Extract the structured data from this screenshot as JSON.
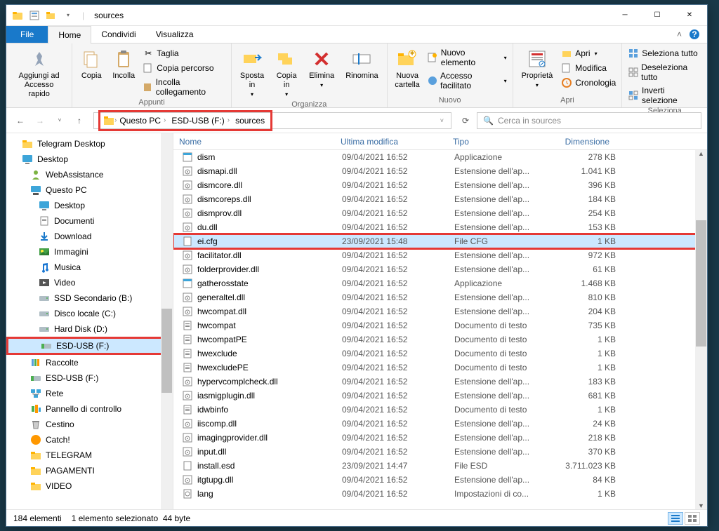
{
  "window": {
    "title": "sources"
  },
  "tabs": {
    "file": "File",
    "home": "Home",
    "share": "Condividi",
    "view": "Visualizza"
  },
  "ribbon": {
    "quick_access": {
      "pin": "Aggiungi ad\nAccesso rapido"
    },
    "clipboard": {
      "group": "Appunti",
      "copy": "Copia",
      "paste": "Incolla",
      "cut": "Taglia",
      "copy_path": "Copia percorso",
      "paste_shortcut": "Incolla collegamento"
    },
    "organize": {
      "group": "Organizza",
      "move": "Sposta\nin",
      "copy_to": "Copia\nin",
      "delete": "Elimina",
      "rename": "Rinomina"
    },
    "new": {
      "group": "Nuovo",
      "new_folder": "Nuova\ncartella",
      "new_item": "Nuovo elemento",
      "easy_access": "Accesso facilitato"
    },
    "open": {
      "group": "Apri",
      "properties": "Proprietà",
      "open": "Apri",
      "edit": "Modifica",
      "history": "Cronologia"
    },
    "select": {
      "group": "Seleziona",
      "select_all": "Seleziona tutto",
      "select_none": "Deseleziona tutto",
      "invert": "Inverti selezione"
    }
  },
  "breadcrumb": {
    "root": "Questo PC",
    "drive": "ESD-USB (F:)",
    "folder": "sources"
  },
  "search": {
    "placeholder": "Cerca in sources"
  },
  "tree": [
    {
      "label": "Telegram Desktop",
      "icon": "folder",
      "lvl": 0
    },
    {
      "label": "Desktop",
      "icon": "desktop",
      "lvl": 0,
      "bold": true
    },
    {
      "label": "WebAssistance",
      "icon": "user",
      "lvl": 1
    },
    {
      "label": "Questo PC",
      "icon": "pc",
      "lvl": 1
    },
    {
      "label": "Desktop",
      "icon": "desktop",
      "lvl": 2
    },
    {
      "label": "Documenti",
      "icon": "docs",
      "lvl": 2
    },
    {
      "label": "Download",
      "icon": "download",
      "lvl": 2
    },
    {
      "label": "Immagini",
      "icon": "images",
      "lvl": 2
    },
    {
      "label": "Musica",
      "icon": "music",
      "lvl": 2
    },
    {
      "label": "Video",
      "icon": "video",
      "lvl": 2
    },
    {
      "label": "SSD Secondario (B:)",
      "icon": "drive",
      "lvl": 2
    },
    {
      "label": "Disco locale (C:)",
      "icon": "drive",
      "lvl": 2
    },
    {
      "label": "Hard Disk (D:)",
      "icon": "drive",
      "lvl": 2
    },
    {
      "label": "ESD-USB (F:)",
      "icon": "usb",
      "lvl": 2,
      "sel": true
    },
    {
      "label": "Raccolte",
      "icon": "lib",
      "lvl": 1
    },
    {
      "label": "ESD-USB (F:)",
      "icon": "usb",
      "lvl": 1
    },
    {
      "label": "Rete",
      "icon": "net",
      "lvl": 1
    },
    {
      "label": "Pannello di controllo",
      "icon": "cp",
      "lvl": 1
    },
    {
      "label": "Cestino",
      "icon": "bin",
      "lvl": 1
    },
    {
      "label": "Catch!",
      "icon": "catch",
      "lvl": 1
    },
    {
      "label": "TELEGRAM",
      "icon": "folder",
      "lvl": 1
    },
    {
      "label": "PAGAMENTI",
      "icon": "folder",
      "lvl": 1
    },
    {
      "label": "VIDEO",
      "icon": "folder",
      "lvl": 1
    }
  ],
  "columns": {
    "name": "Nome",
    "date": "Ultima modifica",
    "type": "Tipo",
    "size": "Dimensione"
  },
  "files": [
    {
      "name": "dism",
      "date": "09/04/2021 16:52",
      "type": "Applicazione",
      "size": "278 KB",
      "icon": "exe"
    },
    {
      "name": "dismapi.dll",
      "date": "09/04/2021 16:52",
      "type": "Estensione dell'ap...",
      "size": "1.041 KB",
      "icon": "dll"
    },
    {
      "name": "dismcore.dll",
      "date": "09/04/2021 16:52",
      "type": "Estensione dell'ap...",
      "size": "396 KB",
      "icon": "dll"
    },
    {
      "name": "dismcoreps.dll",
      "date": "09/04/2021 16:52",
      "type": "Estensione dell'ap...",
      "size": "184 KB",
      "icon": "dll"
    },
    {
      "name": "dismprov.dll",
      "date": "09/04/2021 16:52",
      "type": "Estensione dell'ap...",
      "size": "254 KB",
      "icon": "dll"
    },
    {
      "name": "du.dll",
      "date": "09/04/2021 16:52",
      "type": "Estensione dell'ap...",
      "size": "153 KB",
      "icon": "dll"
    },
    {
      "name": "ei.cfg",
      "date": "23/09/2021 15:48",
      "type": "File CFG",
      "size": "1 KB",
      "icon": "file",
      "sel": true
    },
    {
      "name": "facilitator.dll",
      "date": "09/04/2021 16:52",
      "type": "Estensione dell'ap...",
      "size": "972 KB",
      "icon": "dll"
    },
    {
      "name": "folderprovider.dll",
      "date": "09/04/2021 16:52",
      "type": "Estensione dell'ap...",
      "size": "61 KB",
      "icon": "dll"
    },
    {
      "name": "gatherosstate",
      "date": "09/04/2021 16:52",
      "type": "Applicazione",
      "size": "1.468 KB",
      "icon": "exe"
    },
    {
      "name": "generaltel.dll",
      "date": "09/04/2021 16:52",
      "type": "Estensione dell'ap...",
      "size": "810 KB",
      "icon": "dll"
    },
    {
      "name": "hwcompat.dll",
      "date": "09/04/2021 16:52",
      "type": "Estensione dell'ap...",
      "size": "204 KB",
      "icon": "dll"
    },
    {
      "name": "hwcompat",
      "date": "09/04/2021 16:52",
      "type": "Documento di testo",
      "size": "735 KB",
      "icon": "txt"
    },
    {
      "name": "hwcompatPE",
      "date": "09/04/2021 16:52",
      "type": "Documento di testo",
      "size": "1 KB",
      "icon": "txt"
    },
    {
      "name": "hwexclude",
      "date": "09/04/2021 16:52",
      "type": "Documento di testo",
      "size": "1 KB",
      "icon": "txt"
    },
    {
      "name": "hwexcludePE",
      "date": "09/04/2021 16:52",
      "type": "Documento di testo",
      "size": "1 KB",
      "icon": "txt"
    },
    {
      "name": "hypervcomplcheck.dll",
      "date": "09/04/2021 16:52",
      "type": "Estensione dell'ap...",
      "size": "183 KB",
      "icon": "dll"
    },
    {
      "name": "iasmigplugin.dll",
      "date": "09/04/2021 16:52",
      "type": "Estensione dell'ap...",
      "size": "681 KB",
      "icon": "dll"
    },
    {
      "name": "idwbinfo",
      "date": "09/04/2021 16:52",
      "type": "Documento di testo",
      "size": "1 KB",
      "icon": "txt"
    },
    {
      "name": "iiscomp.dll",
      "date": "09/04/2021 16:52",
      "type": "Estensione dell'ap...",
      "size": "24 KB",
      "icon": "dll"
    },
    {
      "name": "imagingprovider.dll",
      "date": "09/04/2021 16:52",
      "type": "Estensione dell'ap...",
      "size": "218 KB",
      "icon": "dll"
    },
    {
      "name": "input.dll",
      "date": "09/04/2021 16:52",
      "type": "Estensione dell'ap...",
      "size": "370 KB",
      "icon": "dll"
    },
    {
      "name": "install.esd",
      "date": "23/09/2021 14:47",
      "type": "File ESD",
      "size": "3.711.023 KB",
      "icon": "file"
    },
    {
      "name": "itgtupg.dll",
      "date": "09/04/2021 16:52",
      "type": "Estensione dell'ap...",
      "size": "84 KB",
      "icon": "dll"
    },
    {
      "name": "lang",
      "date": "09/04/2021 16:52",
      "type": "Impostazioni di co...",
      "size": "1 KB",
      "icon": "ini"
    }
  ],
  "status": {
    "count": "184 elementi",
    "selected": "1 elemento selezionato",
    "size": "44 byte"
  }
}
